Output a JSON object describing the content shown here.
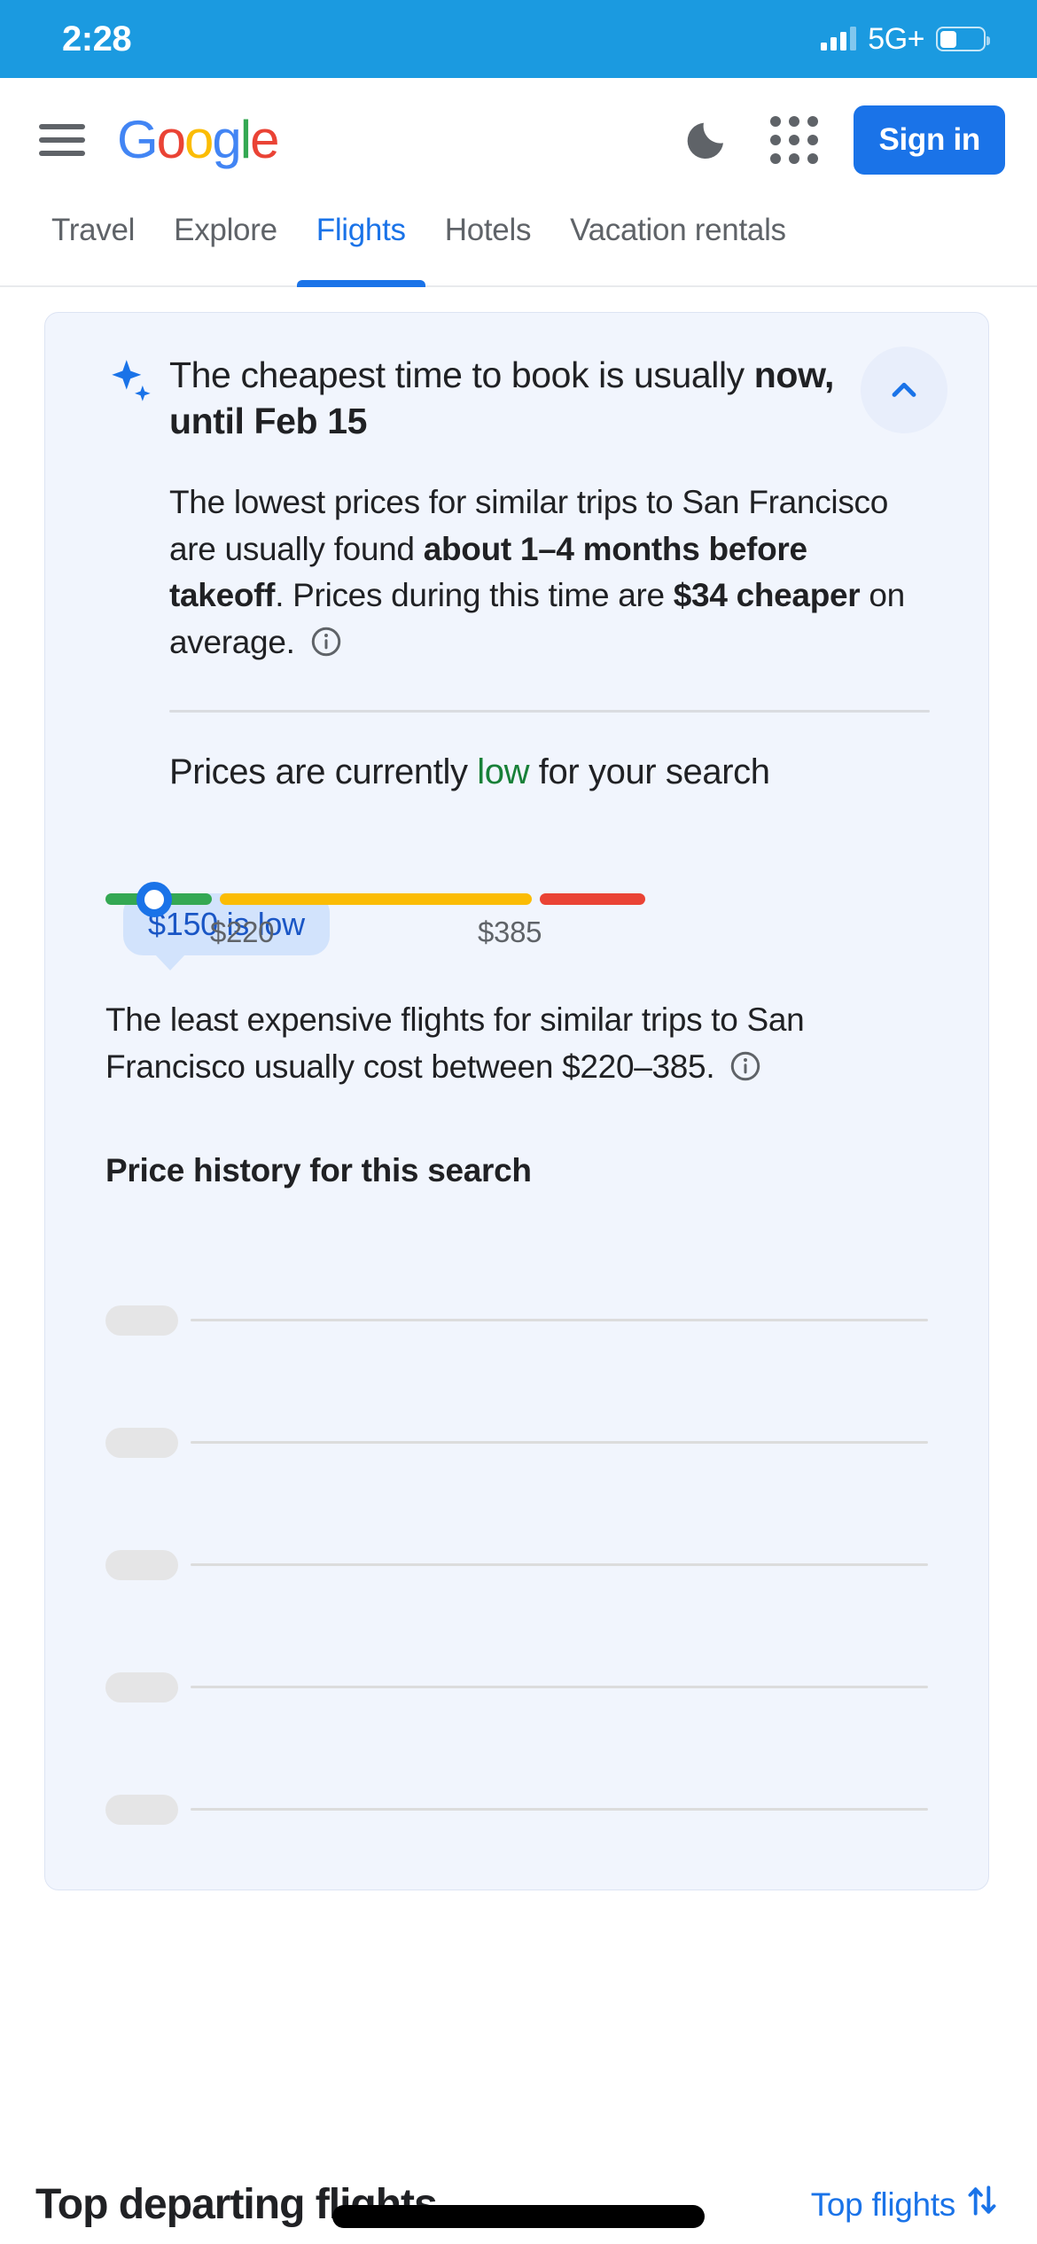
{
  "status_bar": {
    "time": "2:28",
    "network": "5G+",
    "signal_icon": "signal-bars-icon",
    "battery_icon": "battery-icon",
    "battery_level_pct": 40,
    "background_color": "#1b9ae0"
  },
  "header": {
    "menu_icon": "hamburger-menu-icon",
    "logo": {
      "name": "google-logo",
      "letters": [
        {
          "char": "G",
          "color": "#4285f4"
        },
        {
          "char": "o",
          "color": "#ea4335"
        },
        {
          "char": "o",
          "color": "#fbbc05"
        },
        {
          "char": "g",
          "color": "#4285f4"
        },
        {
          "char": "l",
          "color": "#34a853"
        },
        {
          "char": "e",
          "color": "#ea4335"
        }
      ]
    },
    "dark_mode_icon": "moon-icon",
    "apps_icon": "google-apps-grid-icon",
    "sign_in_label": "Sign in",
    "sign_in_color": "#1a73e8"
  },
  "tabs": [
    {
      "label": "Travel",
      "active": false
    },
    {
      "label": "Explore",
      "active": false
    },
    {
      "label": "Flights",
      "active": true
    },
    {
      "label": "Hotels",
      "active": false
    },
    {
      "label": "Vacation rentals",
      "active": false
    }
  ],
  "insight_card": {
    "sparkle_icon": "sparkle-ai-icon",
    "collapse_icon": "chevron-up-icon",
    "headline": {
      "prefix": "The cheapest time to book is usually ",
      "bold": "now, until Feb 15"
    },
    "paragraph": {
      "part1": "The lowest prices for similar trips to San Francisco are usually found ",
      "bold1": "about 1–4 months before takeoff",
      "part2": ". Prices during this time are ",
      "bold2": "$34 cheaper",
      "part3": " on average. ",
      "info_icon": "info-icon"
    },
    "status_line": {
      "prefix": "Prices are currently ",
      "status": "low",
      "status_color": "#188038",
      "suffix": " for your search"
    },
    "price_slider": {
      "tooltip": "$150 is low",
      "tooltip_bg": "#d2e3fc",
      "tooltip_text_color": "#1a56c5",
      "thumb_color": "#1a73e8",
      "low_tick": "$220",
      "high_tick": "$385",
      "segments": [
        {
          "name": "low",
          "color": "#34a853"
        },
        {
          "name": "typical",
          "color": "#fbbc04"
        },
        {
          "name": "high",
          "color": "#ea4335"
        }
      ]
    },
    "explanation": {
      "text": "The least expensive flights for similar trips to San Francisco usually cost between $220–385.",
      "info_icon": "info-icon"
    },
    "price_history_title": "Price history for this search",
    "price_history_loading": true,
    "skeleton_row_count": 5
  },
  "bottom": {
    "section_title": "Top departing flights",
    "sort_label": "Top flights",
    "sort_icon": "sort-arrows-icon",
    "sort_color": "#1a73e8",
    "home_indicator": "home-indicator-bar"
  }
}
